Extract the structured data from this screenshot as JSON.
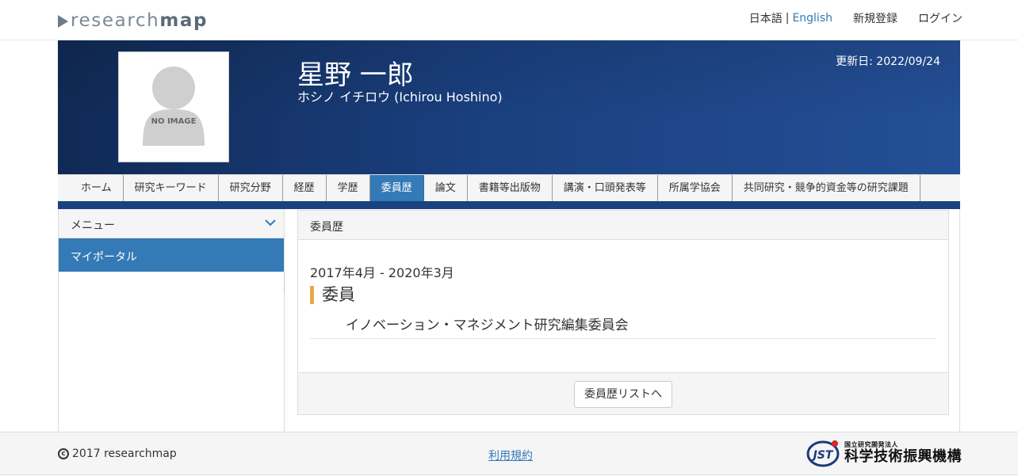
{
  "header": {
    "logo_text_light": "research",
    "logo_text_bold": "map",
    "lang_ja": "日本語",
    "lang_sep": "|",
    "lang_en": "English",
    "register": "新規登録",
    "login": "ログイン"
  },
  "profile": {
    "avatar_text": "NO IMAGE",
    "name": "星野 一郎",
    "kana": "ホシノ イチロウ  (Ichirou Hoshino)",
    "updated": "更新日: 2022/09/24"
  },
  "tabs": [
    {
      "label": "ホーム",
      "active": false
    },
    {
      "label": "研究キーワード",
      "active": false
    },
    {
      "label": "研究分野",
      "active": false
    },
    {
      "label": "経歴",
      "active": false
    },
    {
      "label": "学歴",
      "active": false
    },
    {
      "label": "委員歴",
      "active": true
    },
    {
      "label": "論文",
      "active": false
    },
    {
      "label": "書籍等出版物",
      "active": false
    },
    {
      "label": "講演・口頭発表等",
      "active": false
    },
    {
      "label": "所属学協会",
      "active": false
    },
    {
      "label": "共同研究・競争的資金等の研究課題",
      "active": false
    }
  ],
  "sidebar": {
    "menu_label": "メニュー",
    "items": [
      {
        "label": "マイポータル"
      }
    ]
  },
  "panel": {
    "title": "委員歴",
    "entry": {
      "period": "2017年4月 - 2020年3月",
      "role": "委員",
      "organization": "イノベーション・マネジメント研究編集委員会"
    },
    "list_button": "委員歴リストへ"
  },
  "footer": {
    "copyright": "2017 researchmap",
    "terms": "利用規約",
    "jst_small": "国立研究開発法人",
    "jst_big": "科学技術振興機構",
    "jst_mark": "JST"
  },
  "colors": {
    "accent": "#337ab7",
    "header_blue": "#1a3f7e",
    "title_bar": "#e8a84a"
  }
}
